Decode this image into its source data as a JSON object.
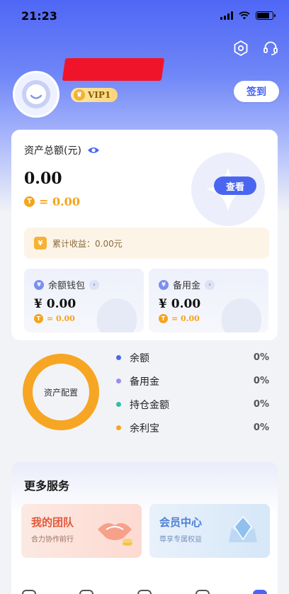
{
  "status_bar": {
    "time": "21:23"
  },
  "profile": {
    "vip_label": "VIP1",
    "checkin_label": "签到"
  },
  "assets": {
    "title": "资产总额(元)",
    "total": "0.00",
    "t_value": "= 0.00",
    "view_label": "查看",
    "earnings_label": "累计收益：0.00元"
  },
  "wallets": [
    {
      "label": "余额钱包",
      "amount": "¥ 0.00",
      "t_value": "= 0.00"
    },
    {
      "label": "备用金",
      "amount": "¥ 0.00",
      "t_value": "= 0.00"
    }
  ],
  "allocation": {
    "center_label": "资产配置",
    "items": [
      {
        "label": "余额",
        "percent": "0%",
        "color": "#4a66f0"
      },
      {
        "label": "备用金",
        "percent": "0%",
        "color": "#9b8cf2"
      },
      {
        "label": "持仓金额",
        "percent": "0%",
        "color": "#2fbfa5"
      },
      {
        "label": "余利宝",
        "percent": "0%",
        "color": "#f6a623"
      }
    ]
  },
  "services": {
    "title": "更多服务",
    "cards": [
      {
        "title": "我的团队",
        "subtitle": "合力协作前行"
      },
      {
        "title": "会员中心",
        "subtitle": "尊享专属权益"
      }
    ]
  },
  "colors": {
    "accent": "#4a66f0",
    "gold": "#f5a41b",
    "ring": "#f6a623"
  }
}
